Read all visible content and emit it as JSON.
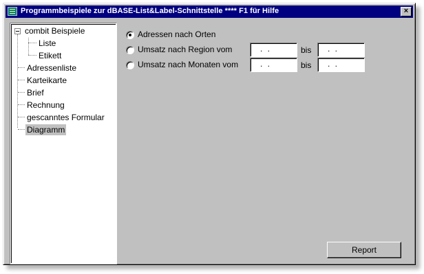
{
  "window": {
    "title": "Programmbeispiele zur dBASE-List&Label-Schnittstelle **** F1 für Hilfe",
    "close_label": "×",
    "titlebar_color": "#000080",
    "face_color": "#c0c0c0"
  },
  "tree": {
    "root": {
      "label": "combit Beispiele",
      "expanded": true
    },
    "children": [
      {
        "label": "Liste"
      },
      {
        "label": "Etikett"
      }
    ],
    "items": [
      {
        "label": "Adressenliste"
      },
      {
        "label": "Karteikarte"
      },
      {
        "label": "Brief"
      },
      {
        "label": "Rechnung"
      },
      {
        "label": "gescanntes Formular"
      },
      {
        "label": "Diagramm",
        "selected": true
      }
    ]
  },
  "options": [
    {
      "label": "Adressen nach Orten",
      "checked": true
    },
    {
      "label": "Umsatz nach Region vom",
      "checked": false,
      "from": ". .",
      "to_label": "bis",
      "to": ". ."
    },
    {
      "label": "Umsatz nach Monaten vom",
      "checked": false,
      "from": ". .",
      "to_label": "bis",
      "to": ". ."
    }
  ],
  "buttons": {
    "report": "Report"
  }
}
